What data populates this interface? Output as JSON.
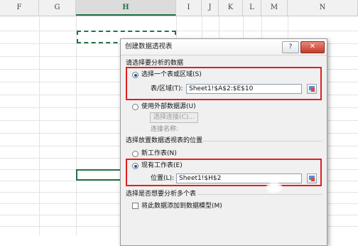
{
  "spreadsheet": {
    "columns": [
      "F",
      "G",
      "H",
      "I",
      "J",
      "K",
      "L",
      "M",
      "N"
    ],
    "selected_column": "H"
  },
  "dialog": {
    "title": "创建数据透视表",
    "help_label": "?",
    "close_label": "✕",
    "section_choose_data": "请选择要分析的数据",
    "option_select_range": "选择一个表或区域(S)",
    "range_label": "表/区域(T):",
    "range_value": "Sheet1!$A$2:$E$10",
    "option_external": "使用外部数据源(U)",
    "choose_connection_label": "选择连接(C)...",
    "connection_name_label": "连接名称:",
    "section_location": "选择放置数据透视表的位置",
    "option_new_sheet": "新工作表(N)",
    "option_existing_sheet": "现有工作表(E)",
    "location_label": "位置(L):",
    "location_value": "Sheet1!$H$2",
    "section_multi": "选择是否想要分析多个表",
    "add_to_model_label": "将此数据添加到数据模型(M)"
  },
  "state": {
    "range_option_selected": true,
    "existing_sheet_selected": true,
    "add_to_model_checked": false
  },
  "colors": {
    "highlight": "#e02020",
    "excel_green": "#217346"
  }
}
